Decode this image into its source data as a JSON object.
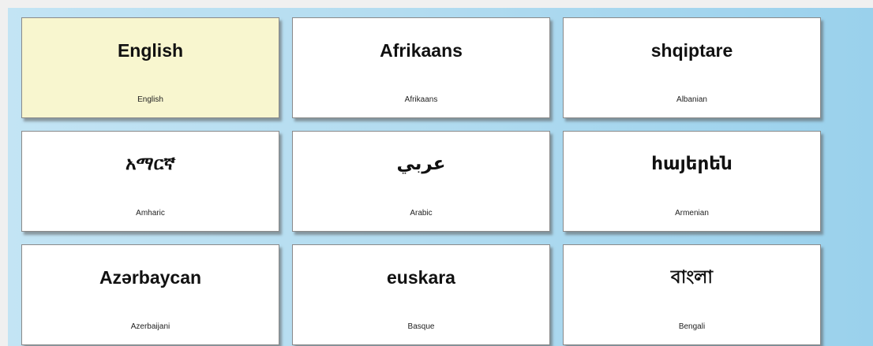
{
  "languages": [
    {
      "native": "English",
      "english": "English",
      "selected": true
    },
    {
      "native": "Afrikaans",
      "english": "Afrikaans"
    },
    {
      "native": "shqiptare",
      "english": "Albanian"
    },
    {
      "native": "አማርኛ",
      "english": "Amharic"
    },
    {
      "native": "عربي",
      "english": "Arabic"
    },
    {
      "native": "հայերեն",
      "english": "Armenian"
    },
    {
      "native": "Azərbaycan",
      "english": "Azerbaijani"
    },
    {
      "native": "euskara",
      "english": "Basque"
    },
    {
      "native": "বাংলা",
      "english": "Bengali"
    }
  ],
  "colors": {
    "selected_card": "#f8f6cf",
    "card": "#ffffff",
    "background_left": "#c3e4f4",
    "background_right": "#9ad1ec"
  }
}
